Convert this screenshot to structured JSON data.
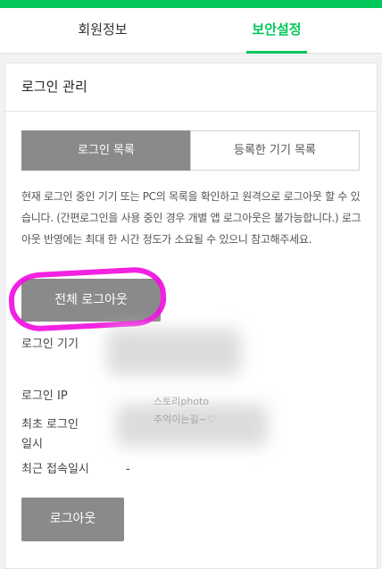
{
  "tabs": [
    {
      "label": "회원정보"
    },
    {
      "label": "보안설정"
    }
  ],
  "section": {
    "title": "로그인 관리"
  },
  "segments": [
    {
      "label": "로그인 목록"
    },
    {
      "label": "등록한 기기 목록"
    }
  ],
  "description": "현재 로그인 중인 기기 또는 PC의 목록을 확인하고 원격으로 로그아웃 할 수 있습니다. (간편로그인을 사용 중인 경우 개별 앱 로그아웃은 불가능합니다.) 로그아웃 반영에는 최대 한 시간 정도가 소요될 수 있으니 참고해주세요.",
  "buttons": {
    "logout_all": "전체 로그아웃",
    "logout": "로그아웃"
  },
  "fields": {
    "device_label": "로그인 기기",
    "ip_label": "로그인 IP",
    "first_login_label": "최초 로그인 일시",
    "recent_access_label": "최근 접속일시",
    "recent_access_value": "-"
  },
  "watermark": {
    "line1": "스토리photo",
    "line2": "추억이는길~♡"
  },
  "colors": {
    "accent": "#03c75a",
    "button_gray": "#8a8a8a",
    "highlight": "#f20ee0"
  }
}
